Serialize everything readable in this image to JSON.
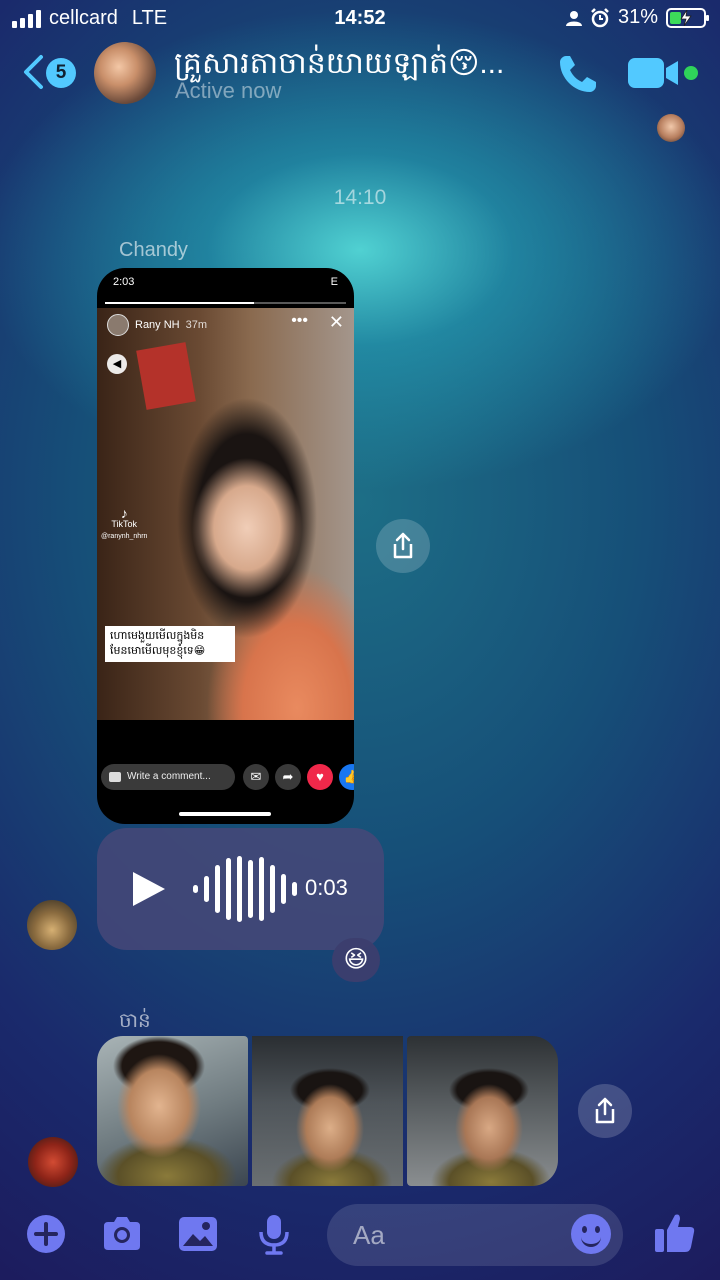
{
  "status": {
    "carrier": "cellcard",
    "network": "LTE",
    "time": "14:52",
    "battery": "31%"
  },
  "header": {
    "back_count": "5",
    "title": "គ្រួសារតាចាន់យាយឡាត់😚...",
    "subtitle": "Active now"
  },
  "conversation": {
    "timestamp": "14:10",
    "sender1": "Chandy",
    "story": {
      "phone_time": "2:03",
      "phone_net": "E",
      "user": "Rany NH",
      "age": "37m",
      "brand": "TikTok",
      "handle": "@ranynh_nhrn",
      "caption": "ហោមេងួយមើលក្នុងមិន មែនមោមើលមុខខ្ញុំទេ😁",
      "comment_placeholder": "Write a comment..."
    },
    "voice_duration": "0:03",
    "reaction": "😆",
    "sender2": "ចាន់"
  },
  "composer": {
    "placeholder": "Aa"
  },
  "colors": {
    "accent": "#52c9ff",
    "composer_icon": "#6f78f0",
    "online": "#2fd35a"
  }
}
